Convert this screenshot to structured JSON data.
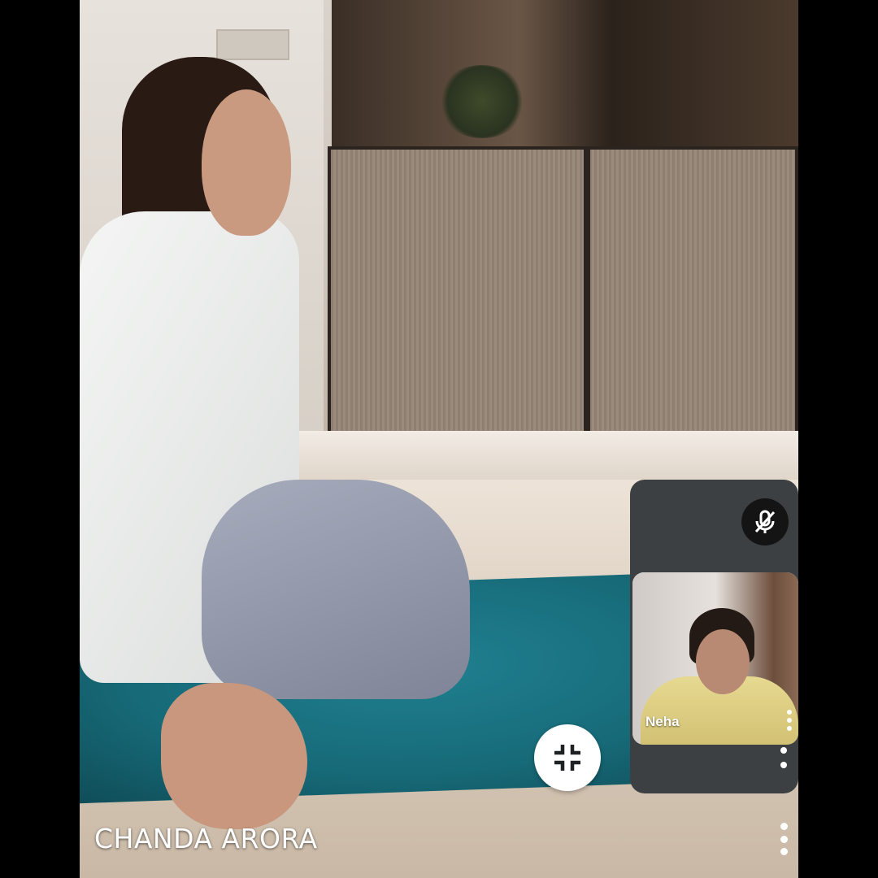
{
  "main_participant": {
    "name": "CHANDA ARORA"
  },
  "self_view": {
    "name": "Neha",
    "mic_muted": true
  },
  "icons": {
    "minimize": "minimize-icon",
    "mic_off": "mic-off-icon",
    "more": "more-vert-icon"
  },
  "colors": {
    "tile_bg": "#3c4043",
    "button_white": "#ffffff",
    "mute_bg": "#141414"
  }
}
